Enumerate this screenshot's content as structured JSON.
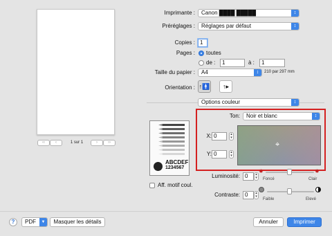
{
  "preview": {
    "page_counter": "1 sur 1",
    "nav_first": "‹‹",
    "nav_prev": "‹",
    "nav_next": "›",
    "nav_last": "››"
  },
  "printer": {
    "label": "Imprimante :",
    "value": "Canon ████ █████"
  },
  "presets": {
    "label": "Préréglages :",
    "value": "Réglages par défaut"
  },
  "copies": {
    "label": "Copies :",
    "value": "1"
  },
  "pages": {
    "label": "Pages :",
    "all_label": "toutes",
    "from_label": "de :",
    "from_value": "1",
    "to_label": "à :",
    "to_value": "1"
  },
  "paper_size": {
    "label": "Taille du papier :",
    "value": "A4",
    "dimensions": "210 par 297 mm"
  },
  "orientation": {
    "label": "Orientation :"
  },
  "section_menu": {
    "value": "Options couleur"
  },
  "color_options": {
    "tone_label": "Ton:",
    "tone_value": "Noir et blanc",
    "x_label": "X:",
    "x_value": "0",
    "y_label": "Y:",
    "y_value": "0",
    "sample_text_1": "ABCDEF",
    "sample_text_2": "1234567",
    "show_pattern_label": "Aff. motif coul.",
    "brightness_label": "Luminosité:",
    "brightness_value": "0",
    "brightness_min": "Foncé",
    "brightness_max": "Clair",
    "contrast_label": "Contraste:",
    "contrast_value": "0",
    "contrast_min": "Faible",
    "contrast_max": "Elevé"
  },
  "footer": {
    "help": "?",
    "pdf": "PDF",
    "hide_details": "Masquer les détails",
    "cancel": "Annuler",
    "print": "Imprimer"
  },
  "colors": {
    "accent": "#3e86e8",
    "highlight_border": "#d42020"
  }
}
